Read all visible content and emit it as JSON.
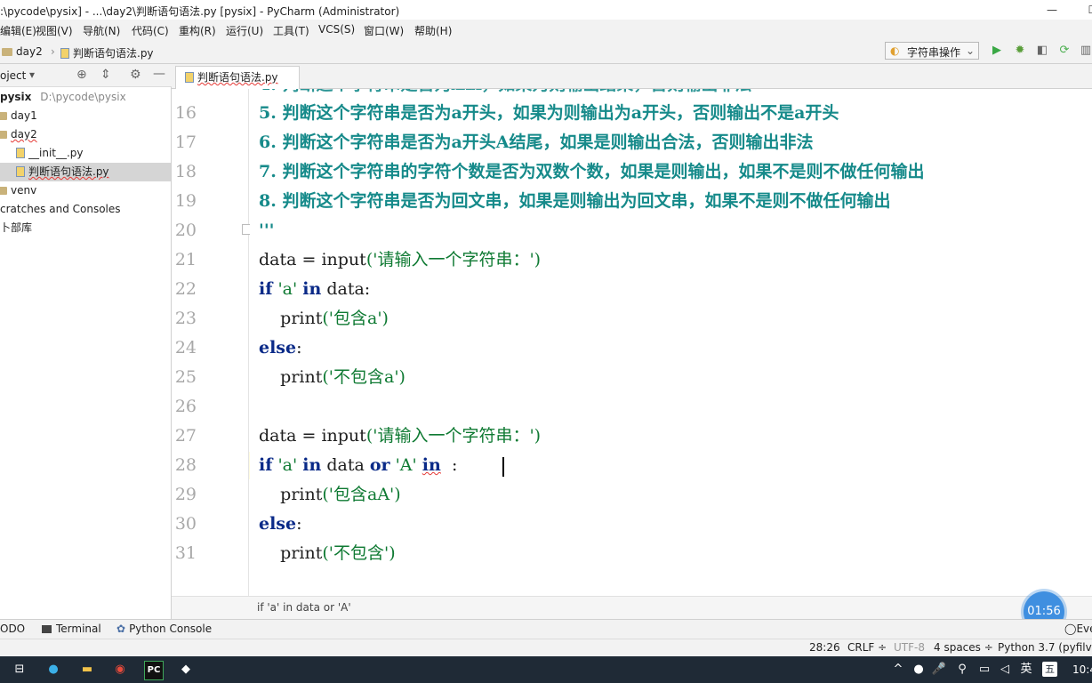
{
  "window": {
    "title": ":\\pycode\\pysix] - ...\\day2\\判断语句语法.py [pysix] - PyCharm (Administrator)",
    "minimize_icon": "minimize-icon",
    "maximize_icon": "maximize-icon",
    "close_icon": "close-icon"
  },
  "menu": [
    "编辑(E)",
    "视图(V)",
    "导航(N)",
    "代码(C)",
    "重构(R)",
    "运行(U)",
    "工具(T)",
    "VCS(S)",
    "窗口(W)",
    "帮助(H)"
  ],
  "navbar": {
    "crumbs": [
      "day2",
      "判断语句语法.py"
    ],
    "run_config": "字符串操作"
  },
  "project": {
    "header": "oject",
    "tree": [
      {
        "label": "pysix",
        "path": "D:\\pycode\\pysix",
        "type": "root"
      },
      {
        "label": "day1",
        "type": "folder"
      },
      {
        "label": "day2",
        "type": "folder"
      },
      {
        "label": "__init__.py",
        "type": "file"
      },
      {
        "label": "判断语句语法.py",
        "type": "file",
        "selected": true
      },
      {
        "label": "venv",
        "type": "folder"
      },
      {
        "label": "cratches and Consoles",
        "type": "scratches"
      },
      {
        "label": "卜部库",
        "type": "lib"
      }
    ]
  },
  "editor": {
    "tab": "判断语句语法.py",
    "line_numbers": [
      "16",
      "17",
      "18",
      "19",
      "20",
      "21",
      "22",
      "23",
      "24",
      "25",
      "26",
      "27",
      "28",
      "29",
      "30",
      "31"
    ],
    "doc_lines": [
      "5. 判断这个字符串是否为a开头，如果为则输出为a开头，否则输出不是a开头",
      "6. 判断这个字符串是否为a开头A结尾，如果是则输出合法，否则输出非法",
      "7. 判断这个字符串的字符个数是否为双数个数，如果是则输出，如果不是则不做任何输出",
      "8. 判断这个字符串是否为回文串，如果是则输出为回文串，如果不是则不做任何输出"
    ],
    "doc_close": "'''",
    "code": {
      "data_var": "data",
      "assign": " = ",
      "input_fn": "input",
      "prompt": "('请输入一个字符串：')",
      "if_kw": "if",
      "str_a": " 'a' ",
      "in_kw": "in",
      "data_colon": " data:",
      "indent": "    ",
      "print_fn": "print",
      "print_a": "('包含a')",
      "else_kw": "else",
      "colon": ":",
      "print_not_a": "('不包含a')",
      "data_word": " data ",
      "or_kw": "or",
      "str_A": " 'A' ",
      "print_aA": "('包含aA')",
      "print_not": "('不包含')"
    },
    "breadcrumb": "if 'a' in data or 'A'"
  },
  "bottom_tabs": [
    "ODO",
    "Terminal",
    "Python Console"
  ],
  "event_log": "Eve",
  "status": {
    "position": "28:26",
    "line_sep": "CRLF ÷",
    "encoding": "UTF-8",
    "indent": "4 spaces ÷",
    "interpreter": "Python 3.7 (pyfilve"
  },
  "timer": "01:56",
  "taskbar": {
    "ime": "英",
    "ime2": "五",
    "clock": "10:4"
  }
}
